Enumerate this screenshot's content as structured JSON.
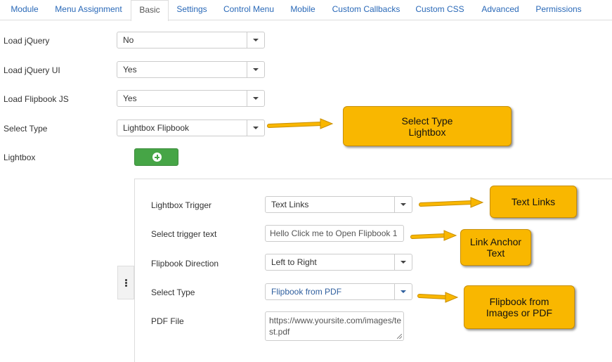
{
  "tabs": [
    "Module",
    "Menu Assignment",
    "Basic",
    "Settings",
    "Control Menu",
    "Mobile",
    "Custom Callbacks",
    "Custom CSS",
    "Advanced",
    "Permissions"
  ],
  "active_tab": "Basic",
  "fields": {
    "load_jquery": {
      "label": "Load jQuery",
      "value": "No"
    },
    "load_jquery_ui": {
      "label": "Load jQuery UI",
      "value": "Yes"
    },
    "load_flipbook_js": {
      "label": "Load Flipbook JS",
      "value": "Yes"
    },
    "select_type": {
      "label": "Select Type",
      "value": "Lightbox Flipbook"
    },
    "lightbox": {
      "label": "Lightbox"
    }
  },
  "subform": {
    "lightbox_trigger": {
      "label": "Lightbox Trigger",
      "value": "Text Links"
    },
    "trigger_text": {
      "label": "Select trigger text",
      "value": "Hello Click me to Open Flipbook 1"
    },
    "flipbook_direction": {
      "label": "Flipbook Direction",
      "value": "Left to Right"
    },
    "select_type": {
      "label": "Select Type",
      "value": "Flipbook from PDF"
    },
    "pdf_file": {
      "label": "PDF File",
      "value": "https://www.yoursite.com/images/test.pdf"
    }
  },
  "callouts": {
    "select_type": "Select Type\nLightbox",
    "text_links": "Text Links",
    "link_anchor": "Link Anchor\nText",
    "flipbook_from": "Flipbook from\nImages or PDF"
  },
  "colors": {
    "accent_link": "#2a69b8",
    "callout": "#f9b700",
    "add_button": "#46a546"
  }
}
